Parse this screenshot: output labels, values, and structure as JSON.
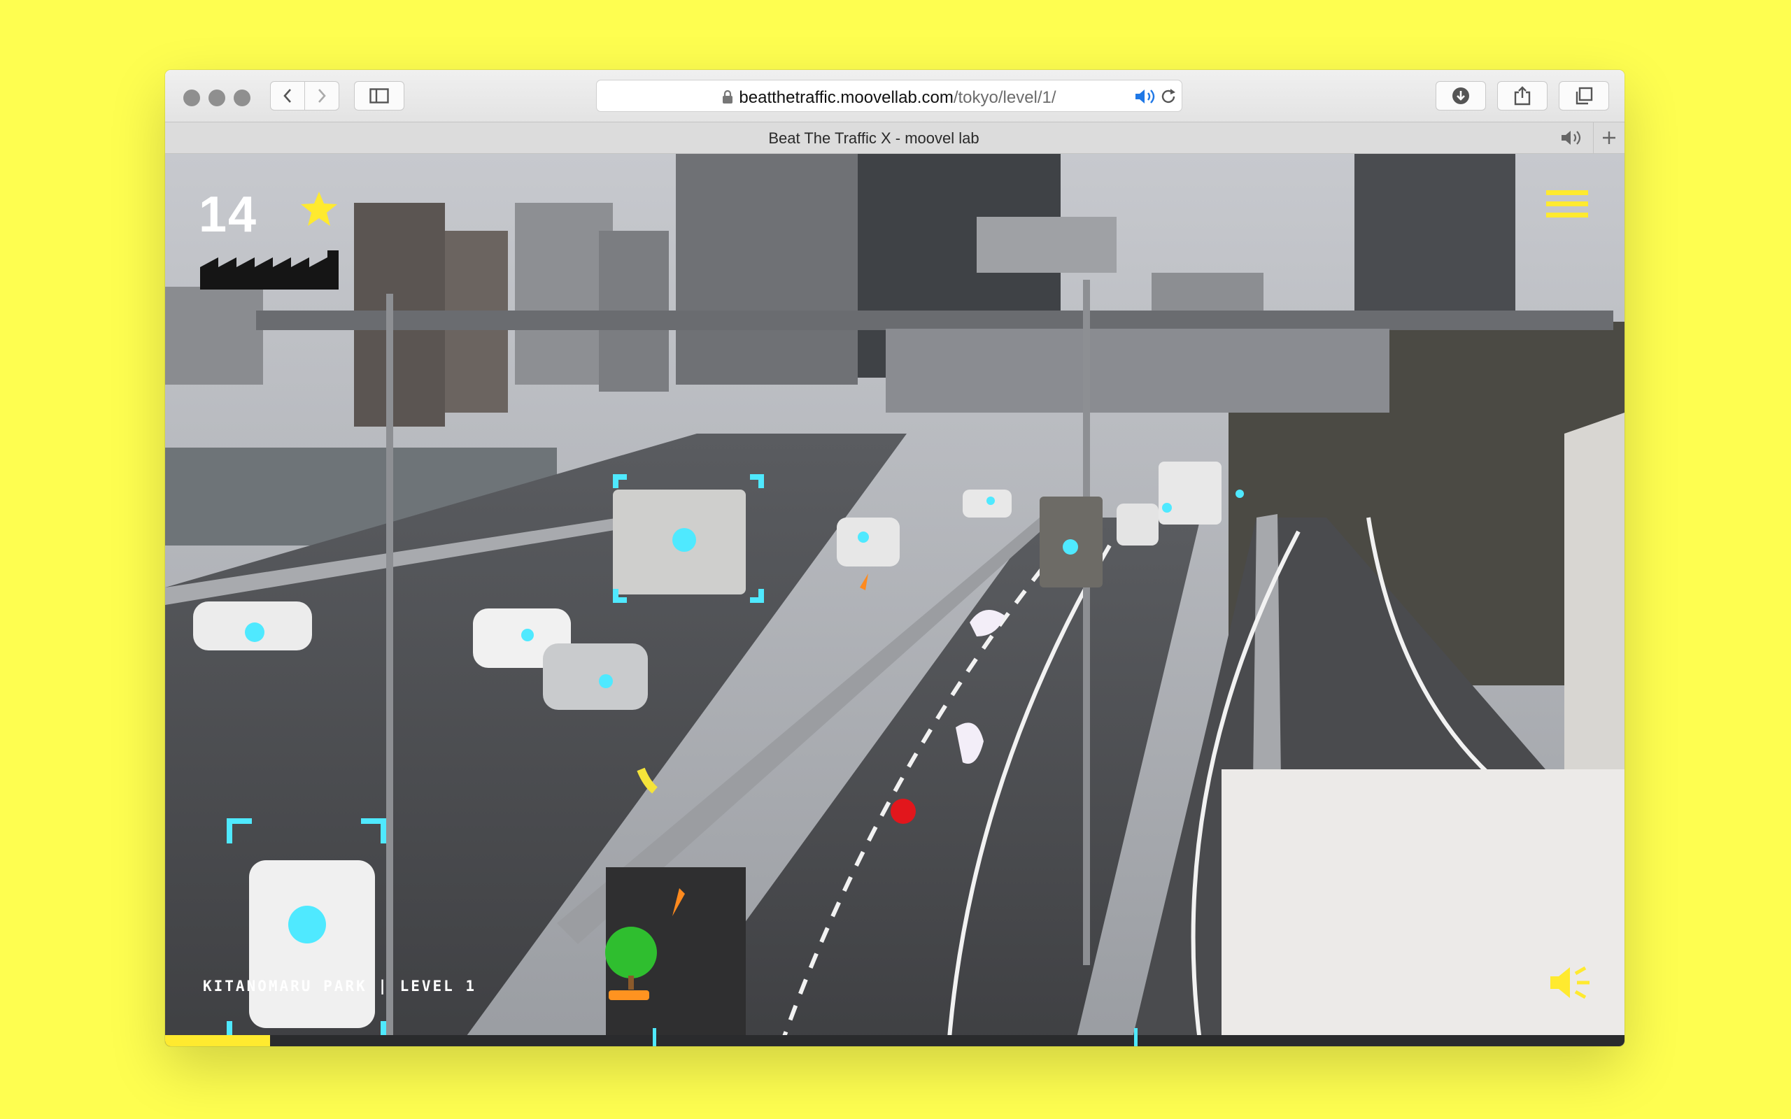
{
  "browser": {
    "url_host": "beatthetraffic.moovellab.com",
    "url_path": "/tokyo/level/1/",
    "tab_title": "Beat The Traffic X - moovel lab",
    "icons": [
      "back-icon",
      "forward-icon",
      "sidebar-icon",
      "lock-icon",
      "audio-icon",
      "reload-icon",
      "download-icon",
      "share-icon",
      "tabs-icon",
      "new-tab-icon"
    ]
  },
  "game": {
    "score": "14",
    "location": "KITANOMARU PARK | LEVEL 1",
    "progress": 0.072,
    "checkpoints": [
      0.335,
      0.665
    ],
    "colors": {
      "accent": "#ffea2f",
      "target": "#4fe9ff",
      "background": "#fefe50"
    }
  }
}
